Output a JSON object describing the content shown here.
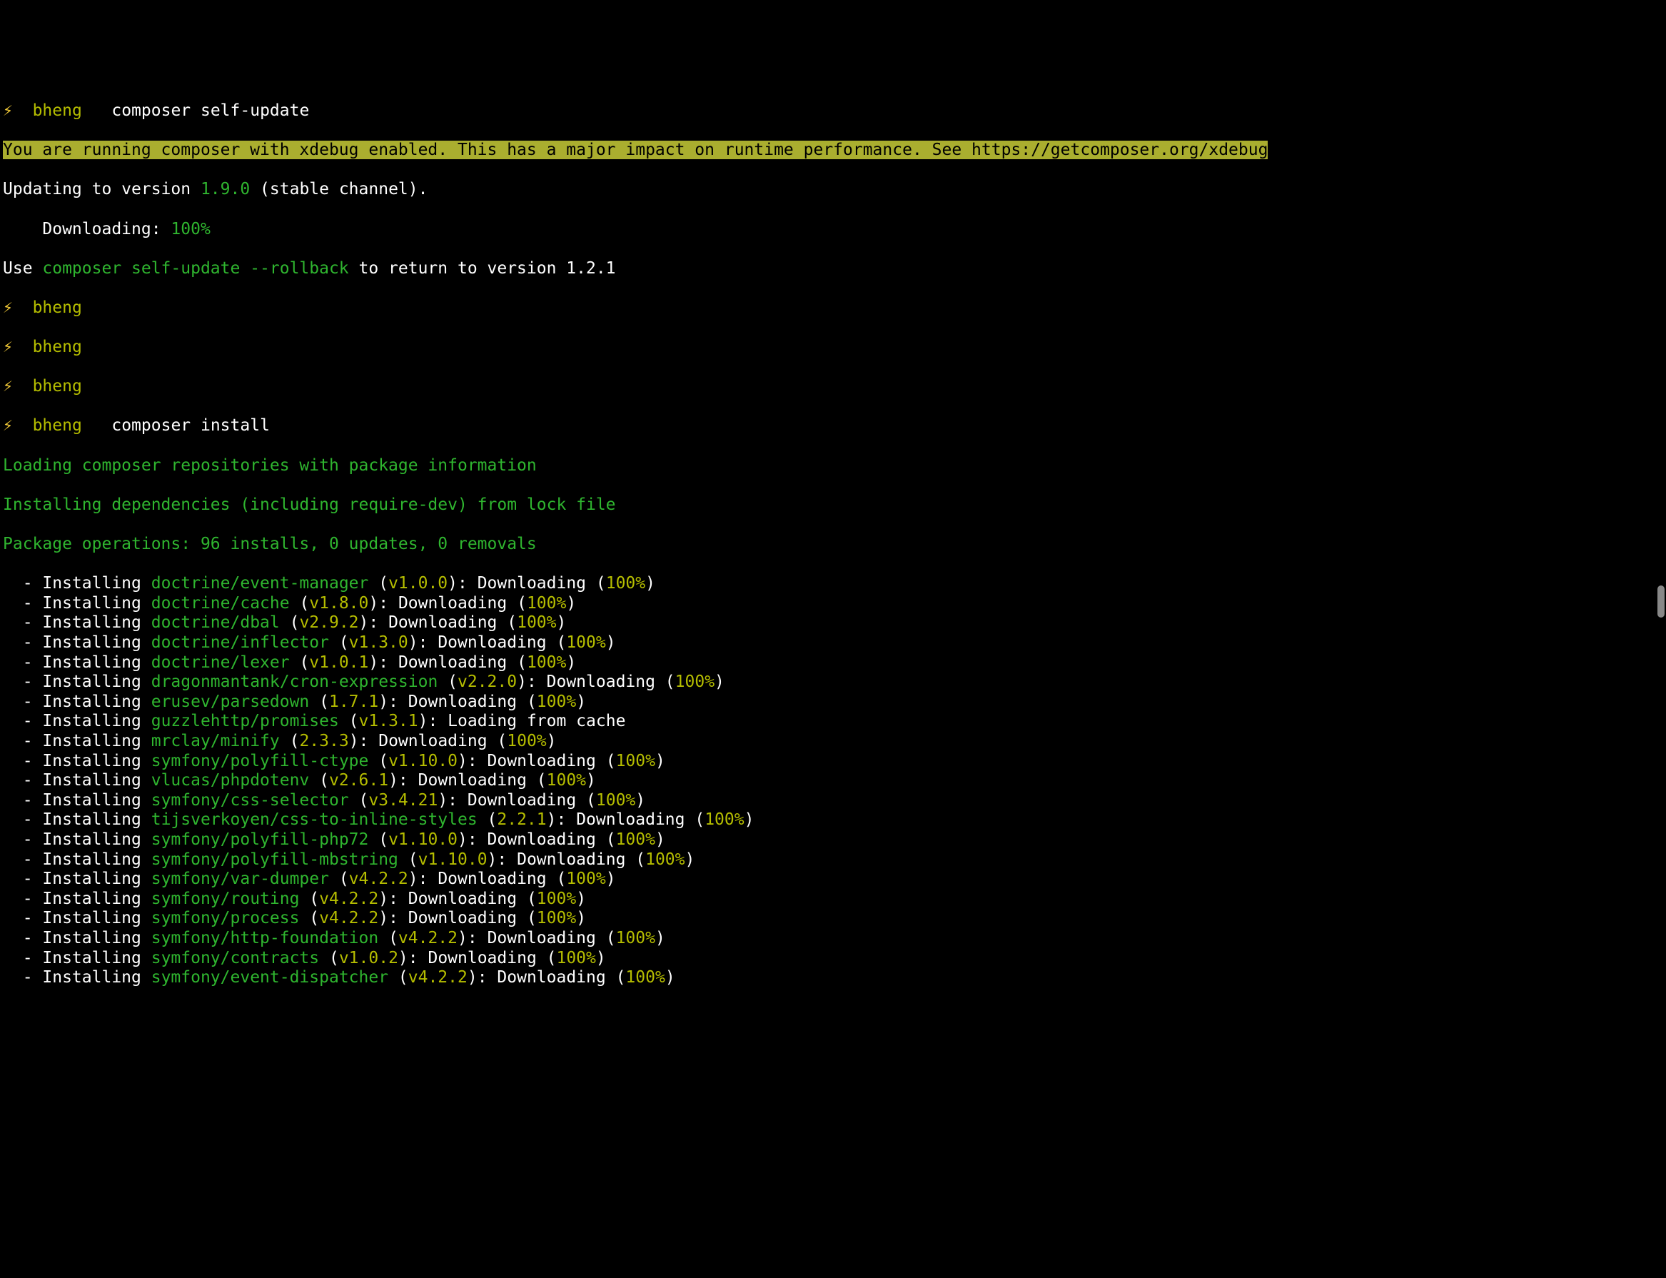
{
  "prompt": {
    "bolt": "⚡",
    "user": "bheng"
  },
  "commands": {
    "self_update": "composer self-update",
    "install": "composer install"
  },
  "warning": {
    "text": "You are running composer with xdebug enabled. This has a major impact on runtime performance. See https://getcomposer.org/xdebug"
  },
  "update": {
    "prefix": "Updating to version ",
    "version": "1.9.0",
    "suffix": " (stable channel).",
    "downloading_label": "    Downloading: ",
    "downloading_pct": "100%",
    "rollback_prefix": "Use ",
    "rollback_cmd": "composer self-update --rollback",
    "rollback_suffix": " to return to version 1.2.1"
  },
  "install": {
    "loading": "Loading composer repositories with package information",
    "installing_deps": "Installing dependencies (including require-dev) from lock file",
    "ops": "Package operations: 96 installs, 0 updates, 0 removals"
  },
  "packages": [
    {
      "name": "doctrine/event-manager",
      "version": "v1.0.0",
      "status_pre": "Downloading (",
      "pct": "100%",
      "status_post": ")"
    },
    {
      "name": "doctrine/cache",
      "version": "v1.8.0",
      "status_pre": "Downloading (",
      "pct": "100%",
      "status_post": ")"
    },
    {
      "name": "doctrine/dbal",
      "version": "v2.9.2",
      "status_pre": "Downloading (",
      "pct": "100%",
      "status_post": ")"
    },
    {
      "name": "doctrine/inflector",
      "version": "v1.3.0",
      "status_pre": "Downloading (",
      "pct": "100%",
      "status_post": ")"
    },
    {
      "name": "doctrine/lexer",
      "version": "v1.0.1",
      "status_pre": "Downloading (",
      "pct": "100%",
      "status_post": ")"
    },
    {
      "name": "dragonmantank/cron-expression",
      "version": "v2.2.0",
      "status_pre": "Downloading (",
      "pct": "100%",
      "status_post": ")"
    },
    {
      "name": "erusev/parsedown",
      "version": "1.7.1",
      "status_pre": "Downloading (",
      "pct": "100%",
      "status_post": ")"
    },
    {
      "name": "guzzlehttp/promises",
      "version": "v1.3.1",
      "status_pre": "Loading from cache",
      "pct": "",
      "status_post": ""
    },
    {
      "name": "mrclay/minify",
      "version": "2.3.3",
      "status_pre": "Downloading (",
      "pct": "100%",
      "status_post": ")"
    },
    {
      "name": "symfony/polyfill-ctype",
      "version": "v1.10.0",
      "status_pre": "Downloading (",
      "pct": "100%",
      "status_post": ")"
    },
    {
      "name": "vlucas/phpdotenv",
      "version": "v2.6.1",
      "status_pre": "Downloading (",
      "pct": "100%",
      "status_post": ")"
    },
    {
      "name": "symfony/css-selector",
      "version": "v3.4.21",
      "status_pre": "Downloading (",
      "pct": "100%",
      "status_post": ")"
    },
    {
      "name": "tijsverkoyen/css-to-inline-styles",
      "version": "2.2.1",
      "status_pre": "Downloading (",
      "pct": "100%",
      "status_post": ")"
    },
    {
      "name": "symfony/polyfill-php72",
      "version": "v1.10.0",
      "status_pre": "Downloading (",
      "pct": "100%",
      "status_post": ")"
    },
    {
      "name": "symfony/polyfill-mbstring",
      "version": "v1.10.0",
      "status_pre": "Downloading (",
      "pct": "100%",
      "status_post": ")"
    },
    {
      "name": "symfony/var-dumper",
      "version": "v4.2.2",
      "status_pre": "Downloading (",
      "pct": "100%",
      "status_post": ")"
    },
    {
      "name": "symfony/routing",
      "version": "v4.2.2",
      "status_pre": "Downloading (",
      "pct": "100%",
      "status_post": ")"
    },
    {
      "name": "symfony/process",
      "version": "v4.2.2",
      "status_pre": "Downloading (",
      "pct": "100%",
      "status_post": ")"
    },
    {
      "name": "symfony/http-foundation",
      "version": "v4.2.2",
      "status_pre": "Downloading (",
      "pct": "100%",
      "status_post": ")"
    },
    {
      "name": "symfony/contracts",
      "version": "v1.0.2",
      "status_pre": "Downloading (",
      "pct": "100%",
      "status_post": ")"
    },
    {
      "name": "symfony/event-dispatcher",
      "version": "v4.2.2",
      "status_pre": "Downloading (",
      "pct": "100%",
      "status_post": ")"
    }
  ],
  "labels": {
    "installing": "Installing",
    "dash": "  - "
  }
}
